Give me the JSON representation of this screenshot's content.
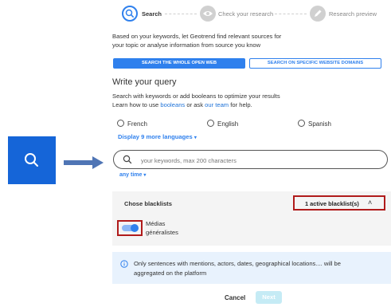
{
  "stepper": {
    "steps": [
      {
        "label": "Search",
        "active": true,
        "icon": "search-icon"
      },
      {
        "label": "Check your research",
        "active": false,
        "icon": "eye-icon"
      },
      {
        "label": "Research preview",
        "active": false,
        "icon": "pencil-icon"
      }
    ]
  },
  "intro": {
    "line1": "Based on your keywords, let Geotrend find relevant sources for",
    "line2": "your topic or analyse information from source you know"
  },
  "source_buttons": {
    "whole_web": "SEARCH THE WHOLE OPEN WEB",
    "specific_domains": "SEARCH ON SPECIFIC WEBSITE DOMAINS"
  },
  "query": {
    "heading": "Write your query",
    "help_line1": "Search with keywords or add booleans to optimize your results",
    "help_line2_prefix": "Learn how to use",
    "booleans_link": "booleans",
    "help_line2_mid": "or ask",
    "team_link": "our team",
    "help_line2_suffix": "for help."
  },
  "languages": {
    "options": [
      "French",
      "English",
      "Spanish"
    ],
    "more": "Display 9 more languages"
  },
  "search": {
    "placeholder": "your keywords, max 200 characters",
    "time_filter": "any time"
  },
  "blacklist": {
    "title": "Chose blacklists",
    "active_label": "1 active blacklist(s)",
    "item_line1": "Médias",
    "item_line2": "généralistes",
    "toggle_on": true
  },
  "info": {
    "line1": "Only sentences with mentions, actors, dates, geographical locations.... will be",
    "line2": "aggregated on the platform"
  },
  "footer": {
    "cancel": "Cancel",
    "next": "Next"
  },
  "colors": {
    "accent": "#2f80ed",
    "annotation_red": "#b01b1b",
    "side_tile": "#1565d8",
    "arrow": "#4f75b5"
  }
}
